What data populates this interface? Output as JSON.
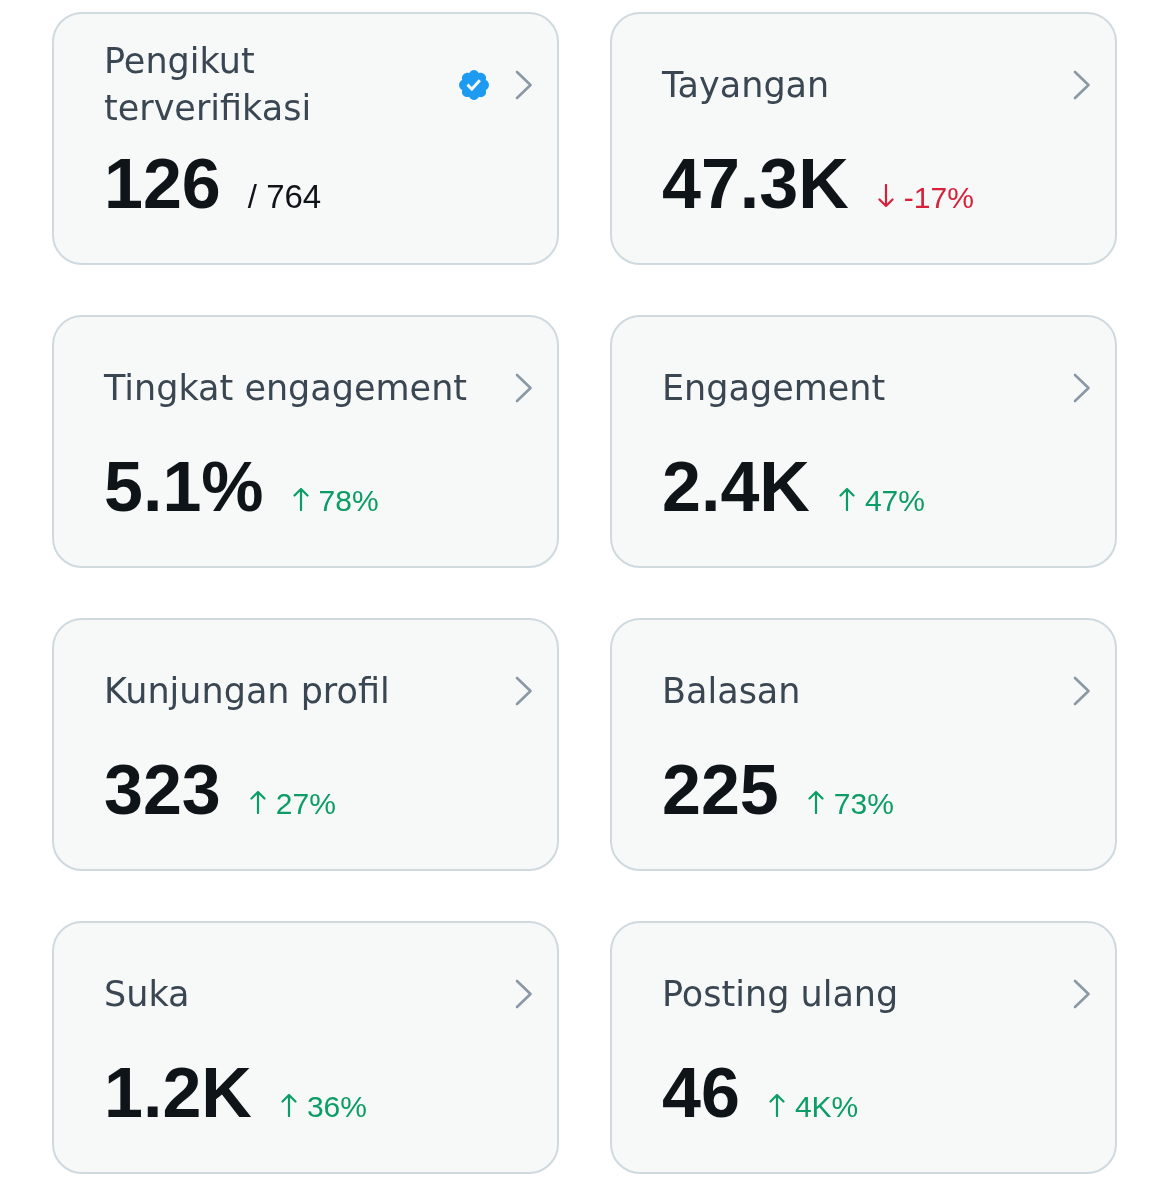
{
  "cards": [
    {
      "title": "Pengikut terverifikasi",
      "verified": true,
      "value": "126",
      "total": "/ 764"
    },
    {
      "title": "Tayangan",
      "verified": false,
      "value": "47.3K",
      "change": "-17%",
      "rising": false
    },
    {
      "title": "Tingkat engagement",
      "verified": false,
      "value": "5.1%",
      "change": "78%",
      "rising": true
    },
    {
      "title": "Engagement",
      "verified": false,
      "value": "2.4K",
      "change": "47%",
      "rising": true
    },
    {
      "title": "Kunjungan profil",
      "verified": false,
      "value": "323",
      "change": "27%",
      "rising": true
    },
    {
      "title": "Balasan",
      "verified": false,
      "value": "225",
      "change": "73%",
      "rising": true
    },
    {
      "title": "Suka",
      "verified": false,
      "value": "1.2K",
      "change": "36%",
      "rising": true
    },
    {
      "title": "Posting ulang",
      "verified": false,
      "value": "46",
      "change": "4K%",
      "rising": true
    }
  ]
}
